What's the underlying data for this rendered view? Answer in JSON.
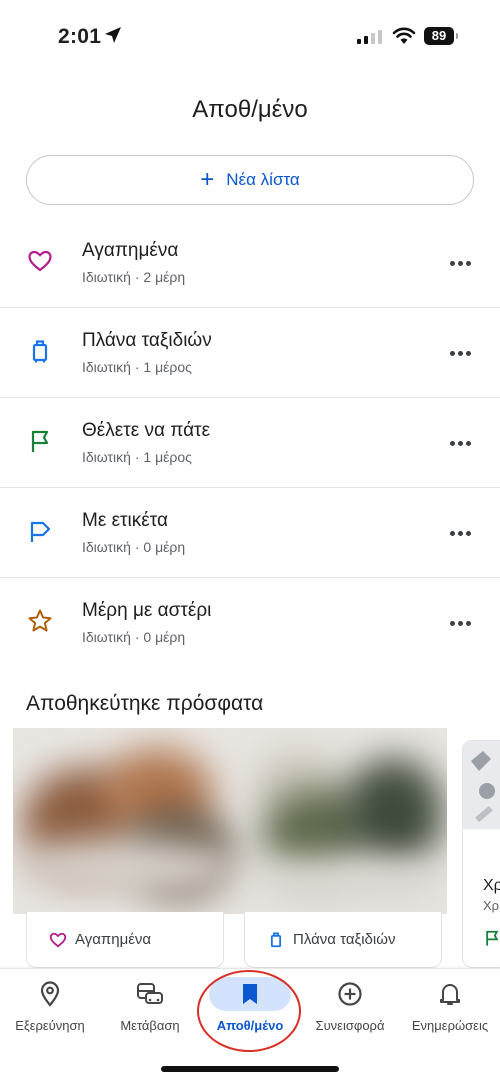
{
  "status_bar": {
    "time": "2:01",
    "battery": "89"
  },
  "header": {
    "title": "Αποθ/μένο"
  },
  "new_list": {
    "label": "Νέα λίστα"
  },
  "lists": [
    {
      "title": "Αγαπημένα",
      "subtitle": "Ιδιωτική · 2 μέρη",
      "icon": "heart-icon",
      "color": "#b21d8c"
    },
    {
      "title": "Πλάνα ταξιδιών",
      "subtitle": "Ιδιωτική · 1 μέρος",
      "icon": "luggage-icon",
      "color": "#1a73e8"
    },
    {
      "title": "Θέλετε να πάτε",
      "subtitle": "Ιδιωτική · 1 μέρος",
      "icon": "flag-icon",
      "color": "#188038"
    },
    {
      "title": "Με ετικέτα",
      "subtitle": "Ιδιωτική · 0 μέρη",
      "icon": "label-flag-icon",
      "color": "#1a73e8"
    },
    {
      "title": "Μέρη με αστέρι",
      "subtitle": "Ιδιωτική · 0 μέρη",
      "icon": "star-icon",
      "color": "#b06000"
    }
  ],
  "recent": {
    "title": "Αποθηκεύτηκε πρόσφατα",
    "cards": [
      {
        "chip_label": "Αγαπημένα",
        "icon": "heart-icon"
      },
      {
        "chip_label": "Πλάνα ταξιδιών",
        "icon": "luggage-icon"
      }
    ],
    "side_card": {
      "title": "Χρ",
      "subtitle": "Χρ"
    }
  },
  "bottom_nav": [
    {
      "label": "Εξερεύνηση",
      "icon": "location-pin-icon",
      "active": false
    },
    {
      "label": "Μετάβαση",
      "icon": "commute-icon",
      "active": false
    },
    {
      "label": "Αποθ/μένο",
      "icon": "bookmark-icon",
      "active": true
    },
    {
      "label": "Συνεισφορά",
      "icon": "add-circle-icon",
      "active": false
    },
    {
      "label": "Ενημερώσεις",
      "icon": "bell-icon",
      "active": false
    }
  ],
  "colors": {
    "accent": "#0b57d0",
    "active_pill": "#d3e3fd",
    "annotation_ring": "#d93025"
  }
}
